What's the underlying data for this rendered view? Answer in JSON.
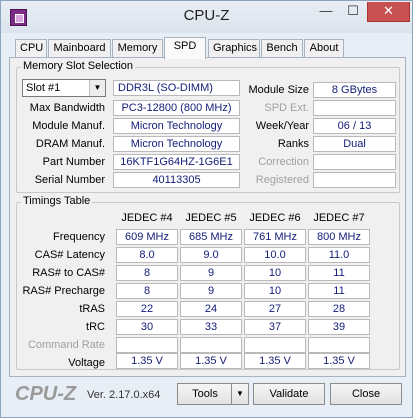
{
  "window": {
    "title": "CPU-Z",
    "min_label": "—",
    "max_label": "☐",
    "close_label": "✕"
  },
  "tabs": [
    {
      "label": "CPU"
    },
    {
      "label": "Mainboard"
    },
    {
      "label": "Memory"
    },
    {
      "label": "SPD"
    },
    {
      "label": "Graphics"
    },
    {
      "label": "Bench"
    },
    {
      "label": "About"
    }
  ],
  "active_tab": "SPD",
  "memory_slot": {
    "group_label": "Memory Slot Selection",
    "slot_value": "Slot #1",
    "module_type": "DDR3L (SO-DIMM)",
    "rows_left": [
      {
        "label": "Max Bandwidth",
        "value": "PC3-12800 (800 MHz)"
      },
      {
        "label": "Module Manuf.",
        "value": "Micron Technology"
      },
      {
        "label": "DRAM Manuf.",
        "value": "Micron Technology"
      },
      {
        "label": "Part Number",
        "value": "16KTF1G64HZ-1G6E1"
      },
      {
        "label": "Serial Number",
        "value": "40113305"
      }
    ],
    "rows_right": [
      {
        "label": "Module Size",
        "value": "8 GBytes",
        "enabled": true
      },
      {
        "label": "SPD Ext.",
        "value": "",
        "enabled": false
      },
      {
        "label": "Week/Year",
        "value": "06 / 13",
        "enabled": true
      },
      {
        "label": "Ranks",
        "value": "Dual",
        "enabled": true
      },
      {
        "label": "Correction",
        "value": "",
        "enabled": false
      },
      {
        "label": "Registered",
        "value": "",
        "enabled": false
      }
    ]
  },
  "timings": {
    "group_label": "Timings Table",
    "columns": [
      "JEDEC #4",
      "JEDEC #5",
      "JEDEC #6",
      "JEDEC #7"
    ],
    "rows": [
      {
        "label": "Frequency",
        "values": [
          "609 MHz",
          "685 MHz",
          "761 MHz",
          "800 MHz"
        ],
        "enabled": true
      },
      {
        "label": "CAS# Latency",
        "values": [
          "8.0",
          "9.0",
          "10.0",
          "11.0"
        ],
        "enabled": true
      },
      {
        "label": "RAS# to CAS#",
        "values": [
          "8",
          "9",
          "10",
          "11"
        ],
        "enabled": true
      },
      {
        "label": "RAS# Precharge",
        "values": [
          "8",
          "9",
          "10",
          "11"
        ],
        "enabled": true
      },
      {
        "label": "tRAS",
        "values": [
          "22",
          "24",
          "27",
          "28"
        ],
        "enabled": true
      },
      {
        "label": "tRC",
        "values": [
          "30",
          "33",
          "37",
          "39"
        ],
        "enabled": true
      },
      {
        "label": "Command Rate",
        "values": [
          "",
          "",
          "",
          ""
        ],
        "enabled": false
      },
      {
        "label": "Voltage",
        "values": [
          "1.35 V",
          "1.35 V",
          "1.35 V",
          "1.35 V"
        ],
        "enabled": true
      }
    ]
  },
  "footer": {
    "logo": "CPU-Z",
    "version": "Ver. 2.17.0.x64",
    "tools_label": "Tools",
    "validate_label": "Validate",
    "close_label": "Close"
  },
  "colors": {
    "value_text": "#16207a",
    "close_button": "#c75050"
  }
}
